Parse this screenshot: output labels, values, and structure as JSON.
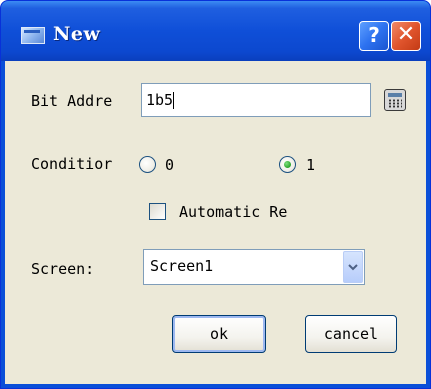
{
  "window": {
    "title": "New"
  },
  "title_buttons": {
    "help": "?",
    "close": "✕"
  },
  "form": {
    "bit_address_label": "Bit Addre",
    "bit_address_value": "1b5",
    "condition_label": "Conditior",
    "radio_0_label": "0",
    "radio_1_label": "1",
    "selected_condition": "1",
    "automatic_label": "Automatic Re",
    "automatic_checked": false,
    "screen_label": "Screen:",
    "screen_value": "Screen1"
  },
  "buttons": {
    "ok": "ok",
    "cancel": "cancel"
  },
  "icons": {
    "title": "window-icon",
    "calculator": "calculator-icon",
    "dropdown": "chevron-down-icon"
  },
  "colors": {
    "titlebar": "#0c48cf",
    "client_bg": "#ece9d8",
    "close_button": "#e0552d",
    "radio_selected": "#2aa42a"
  }
}
